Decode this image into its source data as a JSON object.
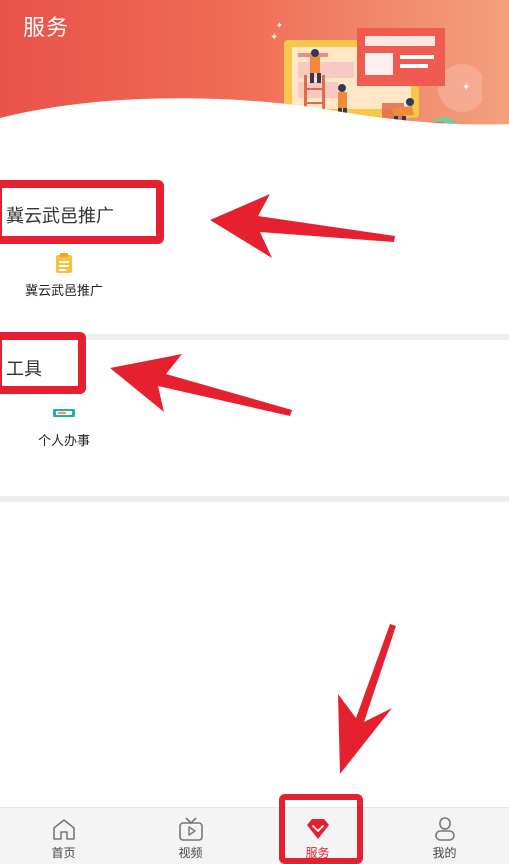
{
  "header": {
    "title": "服务"
  },
  "sections": [
    {
      "title": "冀云武邑推广",
      "items": [
        {
          "label": "冀云武邑推广",
          "icon": "clipboard-icon"
        }
      ]
    },
    {
      "title": "工具",
      "items": [
        {
          "label": "个人办事",
          "icon": "id-card-icon"
        }
      ]
    }
  ],
  "bottom_nav": [
    {
      "label": "首页",
      "icon": "home-icon"
    },
    {
      "label": "视频",
      "icon": "tv-play-icon"
    },
    {
      "label": "服务",
      "icon": "diamond-icon",
      "active": true
    },
    {
      "label": "我的",
      "icon": "user-icon"
    }
  ],
  "colors": {
    "header_start": "#e9524a",
    "header_end": "#f3a07e",
    "accent": "#e5212f",
    "annotation": "#e5212f"
  }
}
